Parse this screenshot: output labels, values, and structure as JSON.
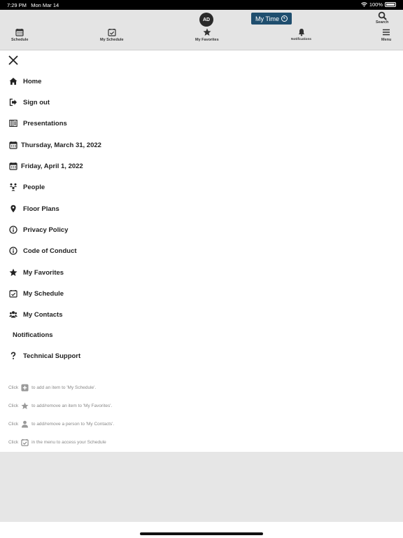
{
  "status_bar": {
    "time": "7:29 PM",
    "date": "Mon Mar 14",
    "battery": "100%"
  },
  "header": {
    "avatar_initials": "AD",
    "my_time_label": "My Time",
    "search_label": "Search",
    "nav": [
      {
        "label": "Schedule",
        "icon": "calendar-icon"
      },
      {
        "label": "My Schedule",
        "icon": "calendar-check-icon"
      },
      {
        "label": "My Favorites",
        "icon": "star-icon"
      },
      {
        "label": "Notifications",
        "icon": "bell-icon"
      },
      {
        "label": "Menu",
        "icon": "hamburger-icon"
      }
    ]
  },
  "menu": {
    "items": [
      {
        "label": "Home",
        "icon": "home-icon"
      },
      {
        "label": "Sign out",
        "icon": "sign-out-icon"
      },
      {
        "label": "Presentations",
        "icon": "presentations-icon"
      },
      {
        "label": "Thursday, March 31, 2022",
        "icon": "calendar-icon"
      },
      {
        "label": "Friday, April 1, 2022",
        "icon": "calendar-icon"
      },
      {
        "label": "People",
        "icon": "people-icon"
      },
      {
        "label": "Floor Plans",
        "icon": "map-pin-icon"
      },
      {
        "label": "Privacy Policy",
        "icon": "info-icon"
      },
      {
        "label": "Code of Conduct",
        "icon": "info-icon"
      },
      {
        "label": "My Favorites",
        "icon": "star-icon"
      },
      {
        "label": "My Schedule",
        "icon": "calendar-check-icon"
      },
      {
        "label": "My Contacts",
        "icon": "contacts-icon"
      },
      {
        "label": "Notifications",
        "icon": ""
      },
      {
        "label": "Technical Support",
        "icon": "question-icon"
      }
    ]
  },
  "hints": [
    {
      "before": "Click",
      "after": "to add an item to 'My Schedule'.",
      "icon": "plus-square-icon"
    },
    {
      "before": "Click",
      "after": "to add/remove an item to 'My Favorites'.",
      "icon": "star-icon"
    },
    {
      "before": "Click",
      "after": "to add/remove a person to 'My Contacts'.",
      "icon": "person-icon"
    },
    {
      "before": "Click",
      "after": "in the menu to access your Schedule",
      "icon": "calendar-check-icon"
    }
  ],
  "colors": {
    "my_time_bg": "#1f4e6e",
    "icon_dark": "#222222",
    "hint_gray": "#888888"
  }
}
